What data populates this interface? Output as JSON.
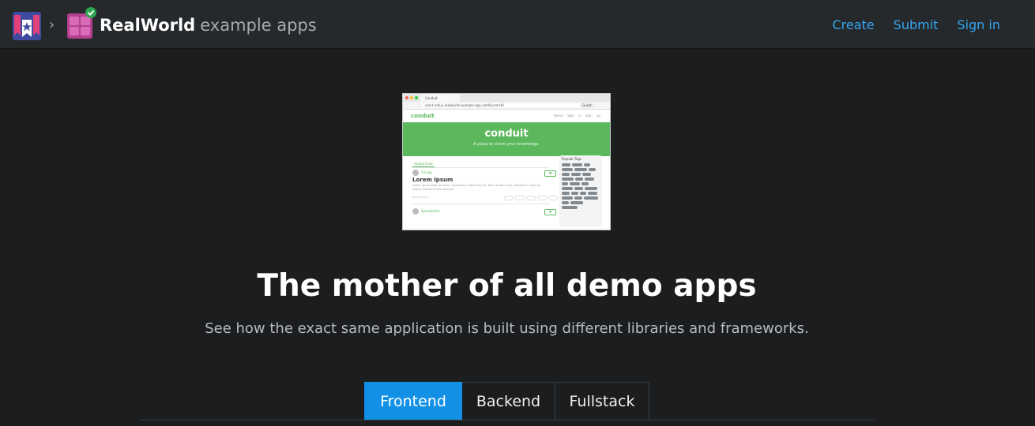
{
  "header": {
    "brand_name": "RealWorld",
    "brand_sub": "example apps",
    "nav": [
      {
        "label": "Create"
      },
      {
        "label": "Submit"
      },
      {
        "label": "Sign in"
      }
    ]
  },
  "preview": {
    "tab_title": "Conduit",
    "address": "react-redux-realworld-example-app.netlify.com/#/",
    "signin_pill": "Guest",
    "nav_brand": "conduit",
    "nav_links": "Home Sign in Sign up",
    "banner_title": "conduit",
    "banner_subtitle": "A place to share your knowledge.",
    "feed_tab": "Global Feed",
    "article1": {
      "author": "Chingy",
      "title": "Lorem Ipsum",
      "preview": "Lorem ipsum dolor sit amet, consectetur adipiscing elit. Nunc at diam sed, vestibulum vehicula augue, blandit at eros aliquam.",
      "read_more": "Read more..."
    },
    "article2": {
      "author": "Speedwithe"
    },
    "sidebar_title": "Popular Tags"
  },
  "hero": {
    "title": "The mother of all demo apps",
    "subtitle": "See how the exact same application is built using different libraries and frameworks."
  },
  "tabs": [
    {
      "label": "Frontend",
      "active": true
    },
    {
      "label": "Backend",
      "active": false
    },
    {
      "label": "Fullstack",
      "active": false
    }
  ],
  "colors": {
    "accent": "#1190e6",
    "link": "#33a7f0",
    "conduit_green": "#5cb85c",
    "background": "#1b1d1f",
    "header_bg": "#26292c"
  }
}
